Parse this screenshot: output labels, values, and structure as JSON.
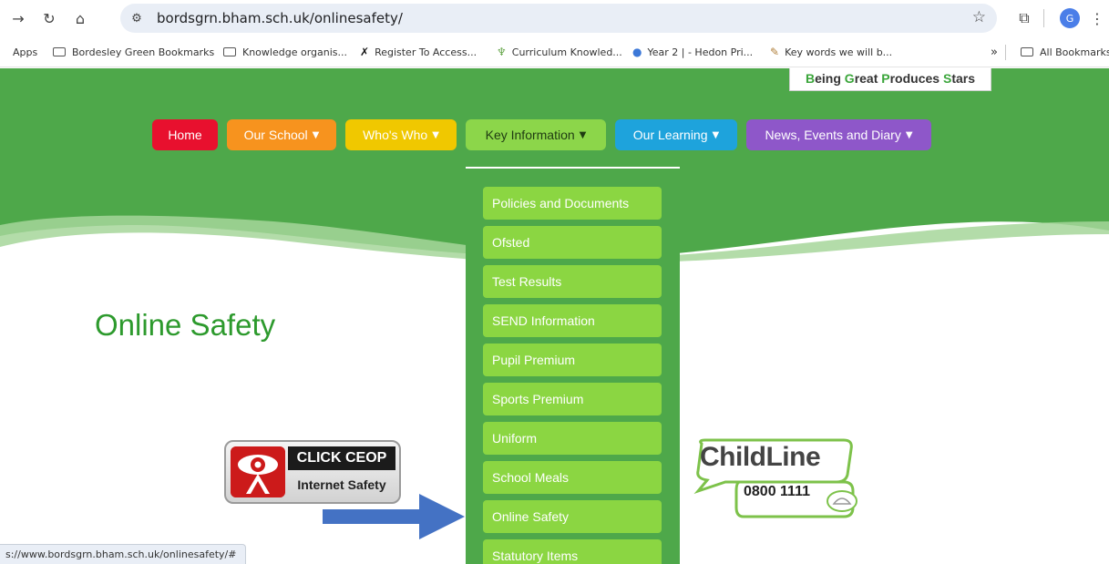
{
  "browser": {
    "url": "bordsgrn.bham.sch.uk/onlinesafety/",
    "bookmarks": [
      "Apps",
      "Bordesley Green Bookmarks",
      "Knowledge organis...",
      "Register To Access...",
      "Curriculum Knowled...",
      "Year 2 | - Hedon Pri...",
      "Key words we will b...",
      "All Bookmarks"
    ],
    "overflow": "»",
    "profile_initial": "G",
    "status_url": "s://www.bordsgrn.bham.sch.uk/onlinesafety/#"
  },
  "site": {
    "motto_parts": [
      "B",
      "eing ",
      "G",
      "reat ",
      "P",
      "roduces ",
      "S",
      "tars"
    ],
    "nav": [
      {
        "label": "Home",
        "color": "#e8102e",
        "has_dropdown": false
      },
      {
        "label": "Our School",
        "color": "#f7931e",
        "has_dropdown": true
      },
      {
        "label": "Who's Who",
        "color": "#f0c800",
        "has_dropdown": true
      },
      {
        "label": "Key Information",
        "color": "#8cd64a",
        "has_dropdown": true
      },
      {
        "label": "Our Learning",
        "color": "#1ea3dc",
        "has_dropdown": true
      },
      {
        "label": "News, Events and Diary",
        "color": "#8e57c9",
        "has_dropdown": true
      }
    ],
    "dropdown_items": [
      "Policies and Documents",
      "Ofsted",
      "Test Results",
      "SEND Information",
      "Pupil Premium",
      "Sports Premium",
      "Uniform",
      "School Meals",
      "Online Safety",
      "Statutory Items"
    ],
    "page_title": "Online Safety",
    "ceop": {
      "top": "CLICK CEOP",
      "bottom": "Internet Safety"
    },
    "childline": {
      "name": "ChildLine",
      "phone": "0800 1111"
    },
    "colors": {
      "banner_green": "#4ea84a",
      "title_green": "#2d9a2d",
      "arrow_blue": "#4472c4"
    }
  }
}
